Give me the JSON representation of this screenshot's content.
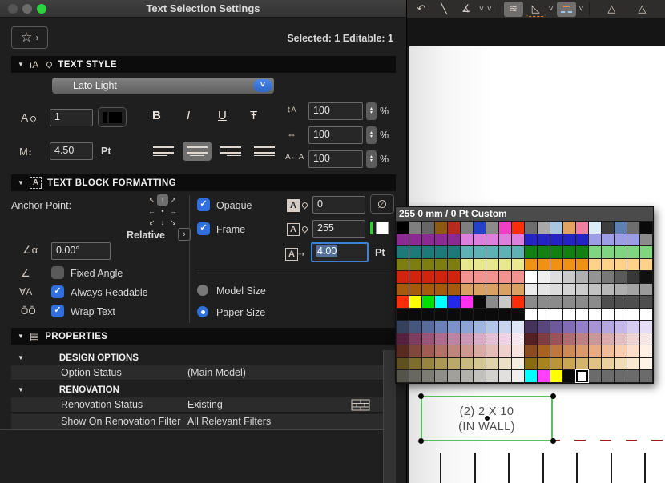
{
  "window": {
    "title": "Text Selection Settings",
    "selection_status": "Selected: 1 Editable: 1"
  },
  "icons": {
    "star": "☆",
    "chevron_right": "›",
    "dropdown_chevron": "˅",
    "section_triangle": "▼",
    "bold": "B",
    "italic": "I",
    "underline": "U",
    "strikethrough": "Ŧ",
    "empty_set": "∅",
    "check": "✓",
    "stepper_up": "▴",
    "stepper_down": "▾",
    "font_letter": "A",
    "m_height": "M",
    "updown": "↕",
    "line_spacing_a": "A",
    "char_width": "⇔",
    "char_spacing": "A↔A",
    "angle": "∠α",
    "fixed_angle": "∠",
    "always_readable": "∀A",
    "wrap_text": "ŎŎ",
    "text_style_header": "ıA",
    "text_block_header": "A",
    "properties_doc": "▤",
    "rotate": "↶",
    "line": "╲",
    "protractor": "∡",
    "toolbar_chevron": "˅",
    "hatch": "≋",
    "set_square": "◺",
    "triangle_a": "△",
    "triangle_b": "△"
  },
  "text_style": {
    "header": "TEXT STYLE",
    "font_name": "Lato Light",
    "font_size_value": "1",
    "height_value": "4.50",
    "height_unit": "Pt",
    "spacing_fields": [
      {
        "value": "100",
        "unit": "%"
      },
      {
        "value": "100",
        "unit": "%"
      },
      {
        "value": "100",
        "unit": "%"
      }
    ]
  },
  "text_block": {
    "header": "TEXT BLOCK FORMATTING",
    "anchor_label": "Anchor Point:",
    "opaque_label": "Opaque",
    "opaque_pen_value": "0",
    "frame_label": "Frame",
    "frame_pen_value": "255",
    "frame_offset_value": "4.00",
    "frame_offset_unit": "Pt",
    "relative_label": "Relative",
    "angle_value": "0.00°",
    "fixed_angle_label": "Fixed Angle",
    "always_readable_label": "Always Readable",
    "wrap_text_label": "Wrap Text",
    "model_size_label": "Model Size",
    "paper_size_label": "Paper Size"
  },
  "properties": {
    "header": "PROPERTIES",
    "groups": [
      {
        "name": "DESIGN OPTIONS",
        "rows": [
          {
            "label": "Option Status",
            "value": "(Main Model)"
          }
        ]
      },
      {
        "name": "RENOVATION",
        "rows": [
          {
            "label": "Renovation Status",
            "value": "Existing"
          },
          {
            "label": "Show On Renovation Filter",
            "value": "All Relevant Filters"
          }
        ]
      }
    ]
  },
  "palette": {
    "title": "255 0 mm / 0 Pt Custom",
    "selected": {
      "row": 12,
      "col": 14
    },
    "rows": [
      [
        "#000000",
        "#7f7f7f",
        "#666666",
        "#8e5a12",
        "#b62b1c",
        "#7f7f7f",
        "#2442c8",
        "#8b8b8b",
        "#f03fc3",
        "#fa2e0a",
        "#6e6e6e",
        "#a8a8a8",
        "#a9c6e0",
        "#e2a360",
        "#ee7f9e",
        "#dcebf8",
        "#3d3d3d",
        "#5d7fb2",
        "#6e6e6e",
        "#0a0a0a"
      ],
      [
        "#8b2a92",
        "#8b2a92",
        "#8b2a92",
        "#8b2a92",
        "#8b2a92",
        "#dd7fdd",
        "#dd7fdd",
        "#dd7fdd",
        "#dd7fdd",
        "#dd7fdd",
        "#2424c4",
        "#2424c4",
        "#2424c4",
        "#2424c4",
        "#2424c4",
        "#9c9de6",
        "#9c9de6",
        "#9c9de6",
        "#9c9de6",
        "#8b8b8b"
      ],
      [
        "#1d7a78",
        "#1d7a78",
        "#1d7a78",
        "#1d7a78",
        "#1d7a78",
        "#5fb2b4",
        "#5fb2b4",
        "#5fb2b4",
        "#5fb2b4",
        "#5fb2b4",
        "#128012",
        "#128012",
        "#128012",
        "#128012",
        "#128012",
        "#7fd67f",
        "#7fd67f",
        "#7fd67f",
        "#7fd67f",
        "#7fd67f"
      ],
      [
        "#7e7e10",
        "#7e7e10",
        "#7e7e10",
        "#7e7e10",
        "#7e7e10",
        "#e8e88e",
        "#e8e88e",
        "#e8e88e",
        "#e8e88e",
        "#e8e88e",
        "#ef9214",
        "#ef9214",
        "#ef9214",
        "#ef9214",
        "#ef9214",
        "#fed288",
        "#fed288",
        "#fed288",
        "#fed288",
        "#fed288"
      ],
      [
        "#d0240e",
        "#d0240e",
        "#d0240e",
        "#d0240e",
        "#d0240e",
        "#f29390",
        "#f29390",
        "#f29390",
        "#f29390",
        "#f29390",
        "#ffffff",
        "#f0f0f0",
        "#dedede",
        "#cacaca",
        "#b0b0b0",
        "#949494",
        "#787878",
        "#5a5a5a",
        "#383838",
        "#101010"
      ],
      [
        "#a55a0e",
        "#a55a0e",
        "#a55a0e",
        "#a55a0e",
        "#a55a0e",
        "#d9a262",
        "#d9a262",
        "#d9a262",
        "#d9a262",
        "#d9a262",
        "#ebebeb",
        "#e4e4e4",
        "#dcdcdc",
        "#d4d4d4",
        "#cccccc",
        "#c2c2c2",
        "#b8b8b8",
        "#aeaeae",
        "#a4a4a4",
        "#9a9a9a"
      ],
      [
        "#fa2e0a",
        "#ffff00",
        "#00e000",
        "#00ffff",
        "#2428e8",
        "#ff30f0",
        "#0a0a0a",
        "#8b8b8b",
        "#c8c8c8",
        "#fa2e0a",
        "#8b8b8b",
        "#8b8b8b",
        "#8b8b8b",
        "#8b8b8b",
        "#8b8b8b",
        "#8b8b8b",
        "#4e4e4e",
        "#4e4e4e",
        "#4e4e4e",
        "#4e4e4e"
      ],
      [
        "#0b0b0b",
        "#0b0b0b",
        "#0b0b0b",
        "#0b0b0b",
        "#0b0b0b",
        "#0b0b0b",
        "#0b0b0b",
        "#0b0b0b",
        "#0b0b0b",
        "#0b0b0b",
        "#ffffff",
        "#ffffff",
        "#ffffff",
        "#ffffff",
        "#ffffff",
        "#ffffff",
        "#ffffff",
        "#ffffff",
        "#ffffff",
        "#ffffff"
      ],
      [
        "#35405c",
        "#47567e",
        "#596b9c",
        "#6b80b6",
        "#7d92c8",
        "#8fa4d6",
        "#a1b5e2",
        "#b3c5ea",
        "#c9d5f0",
        "#dde5f6",
        "#46335c",
        "#5a467e",
        "#6e599c",
        "#826cb6",
        "#9480c8",
        "#a694d6",
        "#b6a6e2",
        "#c6b8ea",
        "#d6cbf0",
        "#e6ddf6"
      ],
      [
        "#56203f",
        "#7e3c60",
        "#9a547a",
        "#ae6c90",
        "#bd82a4",
        "#cb97b6",
        "#d8abc6",
        "#e3bfd5",
        "#edd3e3",
        "#f6e7f0",
        "#561f22",
        "#7e3b40",
        "#9a5358",
        "#ae6b70",
        "#bd8184",
        "#cb9698",
        "#d8aaac",
        "#e3bec0",
        "#edd2d3",
        "#f6e6e6"
      ],
      [
        "#592a20",
        "#82473c",
        "#9e5c52",
        "#b27268",
        "#c0857c",
        "#ce9890",
        "#daaba4",
        "#e4bdb8",
        "#eed0cc",
        "#f7e4e1",
        "#8a4c20",
        "#a8641f",
        "#bc7840",
        "#cc8a58",
        "#da9a6c",
        "#e8ab82",
        "#f2bc98",
        "#f9cdb0",
        "#fddeca",
        "#ffefe4"
      ],
      [
        "#5e511e",
        "#7e6e2e",
        "#968440",
        "#aa9854",
        "#baa968",
        "#c8b97e",
        "#d4c794",
        "#e0d4ac",
        "#eae1c6",
        "#f4eee0",
        "#8a6c10",
        "#a8841e",
        "#ba9638",
        "#c8a652",
        "#d4b46a",
        "#e0c284",
        "#e9d09e",
        "#f1dcb8",
        "#f8e8d0",
        "#fdf3e6"
      ],
      [
        "#55544a",
        "#696860",
        "#7c7b74",
        "#8f8e88",
        "#a1a09a",
        "#b2b1ac",
        "#c2c1bd",
        "#d2d1ce",
        "#e1e0de",
        "#f0efee",
        "#00ffff",
        "#ff40ff",
        "#ffff00",
        "#0a0a0a",
        "#ffffff",
        "#6b6b6b",
        "#6b6b6b",
        "#6b6b6b",
        "#6b6b6b",
        "#6b6b6b"
      ]
    ]
  },
  "canvas": {
    "text_line1": "(2) 2 X 10",
    "text_line2": "(IN WALL)",
    "selection_color": "#5abf5a",
    "dash_color": "#9c1d12"
  }
}
